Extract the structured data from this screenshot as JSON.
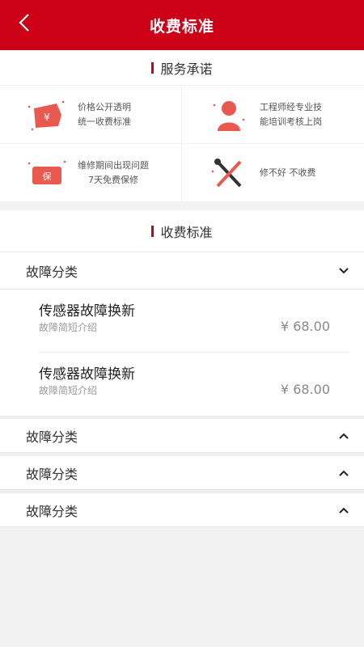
{
  "header": {
    "title": "收费标准"
  },
  "promise": {
    "heading": "服务承诺",
    "items": [
      {
        "icon": "yen-tag-icon",
        "line1": "价格公开透明",
        "line2": "统一收费标准"
      },
      {
        "icon": "engineer-icon",
        "line1": "工程师经专业技",
        "line2": "能培训考核上岗"
      },
      {
        "icon": "warranty-icon",
        "line1": "维修期间出现问题",
        "line2": "7天免费保修"
      },
      {
        "icon": "tools-icon",
        "line1": "修不好 不收费",
        "line2": ""
      }
    ]
  },
  "fee": {
    "heading": "收费标准",
    "categories": [
      {
        "label": "故障分类",
        "expanded": true,
        "items": [
          {
            "name": "传感器故障换新",
            "desc": "故障简短介绍",
            "price": "¥ 68.00"
          },
          {
            "name": "传感器故障换新",
            "desc": "故障简短介绍",
            "price": "¥ 68.00"
          }
        ]
      },
      {
        "label": "故障分类",
        "expanded": false
      },
      {
        "label": "故障分类",
        "expanded": false
      },
      {
        "label": "故障分类",
        "expanded": false
      }
    ]
  },
  "colors": {
    "brand": "#cc0016",
    "icon_red": "#e85a4f"
  }
}
